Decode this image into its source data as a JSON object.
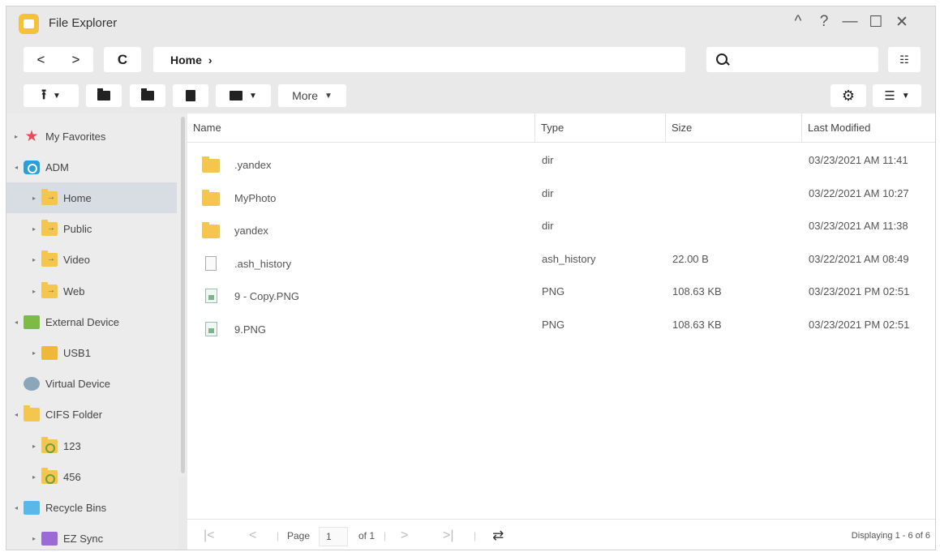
{
  "window": {
    "title": "File Explorer"
  },
  "window_controls": {
    "collapse": "^",
    "help": "?",
    "minimize": "—",
    "maximize": "☐",
    "close": "✕"
  },
  "nav": {
    "back": "<",
    "forward": ">",
    "refresh": "C"
  },
  "path": {
    "segment": "Home",
    "separator": "›"
  },
  "search": {
    "value": "",
    "placeholder": ""
  },
  "toolbar": {
    "more_label": "More"
  },
  "tree": [
    {
      "label": "My Favorites",
      "icon": "star-icon",
      "indent": 0,
      "toggle": "▸"
    },
    {
      "label": "ADM",
      "icon": "adm-icon",
      "indent": 0,
      "toggle": "◂"
    },
    {
      "label": "Home",
      "icon": "shared-folder-icon",
      "indent": 1,
      "toggle": "▸",
      "selected": true
    },
    {
      "label": "Public",
      "icon": "shared-folder-icon",
      "indent": 1,
      "toggle": "▸"
    },
    {
      "label": "Video",
      "icon": "shared-folder-icon",
      "indent": 1,
      "toggle": "▸"
    },
    {
      "label": "Web",
      "icon": "shared-folder-icon",
      "indent": 1,
      "toggle": "▸"
    },
    {
      "label": "External Device",
      "icon": "external-device-icon",
      "indent": 0,
      "toggle": "◂"
    },
    {
      "label": "USB1",
      "icon": "usb-icon",
      "indent": 1,
      "toggle": "▸"
    },
    {
      "label": "Virtual Device",
      "icon": "virtual-device-icon",
      "indent": 0,
      "toggle": ""
    },
    {
      "label": "CIFS Folder",
      "icon": "folder-icon",
      "indent": 0,
      "toggle": "◂"
    },
    {
      "label": "123",
      "icon": "network-folder-icon",
      "indent": 1,
      "toggle": "▸"
    },
    {
      "label": "456",
      "icon": "network-folder-icon",
      "indent": 1,
      "toggle": "▸"
    },
    {
      "label": "Recycle Bins",
      "icon": "recycle-bin-icon",
      "indent": 0,
      "toggle": "◂"
    },
    {
      "label": "EZ Sync",
      "icon": "ez-sync-icon",
      "indent": 1,
      "toggle": "▸"
    }
  ],
  "table": {
    "columns": [
      "Name",
      "Type",
      "Size",
      "Last Modified"
    ],
    "rows": [
      {
        "name": ".yandex",
        "type": "dir",
        "size": "",
        "modified": "03/23/2021 AM 11:41",
        "icon": "folder-icon"
      },
      {
        "name": "MyPhoto",
        "type": "dir",
        "size": "",
        "modified": "03/22/2021 AM 10:27",
        "icon": "folder-icon"
      },
      {
        "name": "yandex",
        "type": "dir",
        "size": "",
        "modified": "03/23/2021 AM 11:38",
        "icon": "folder-icon"
      },
      {
        "name": ".ash_history",
        "type": "ash_history",
        "size": "22.00 B",
        "modified": "03/22/2021 AM 08:49",
        "icon": "file-icon"
      },
      {
        "name": "9 - Copy.PNG",
        "type": "PNG",
        "size": "108.63 KB",
        "modified": "03/23/2021 PM 02:51",
        "icon": "image-file-icon"
      },
      {
        "name": "9.PNG",
        "type": "PNG",
        "size": "108.63 KB",
        "modified": "03/23/2021 PM 02:51",
        "icon": "image-file-icon"
      }
    ]
  },
  "pager": {
    "first": "|<",
    "prev": "<",
    "page_label": "Page",
    "page_value": "1",
    "of_label": "of 1",
    "next": ">",
    "last": ">|",
    "displaying": "Displaying 1 - 6 of 6"
  }
}
